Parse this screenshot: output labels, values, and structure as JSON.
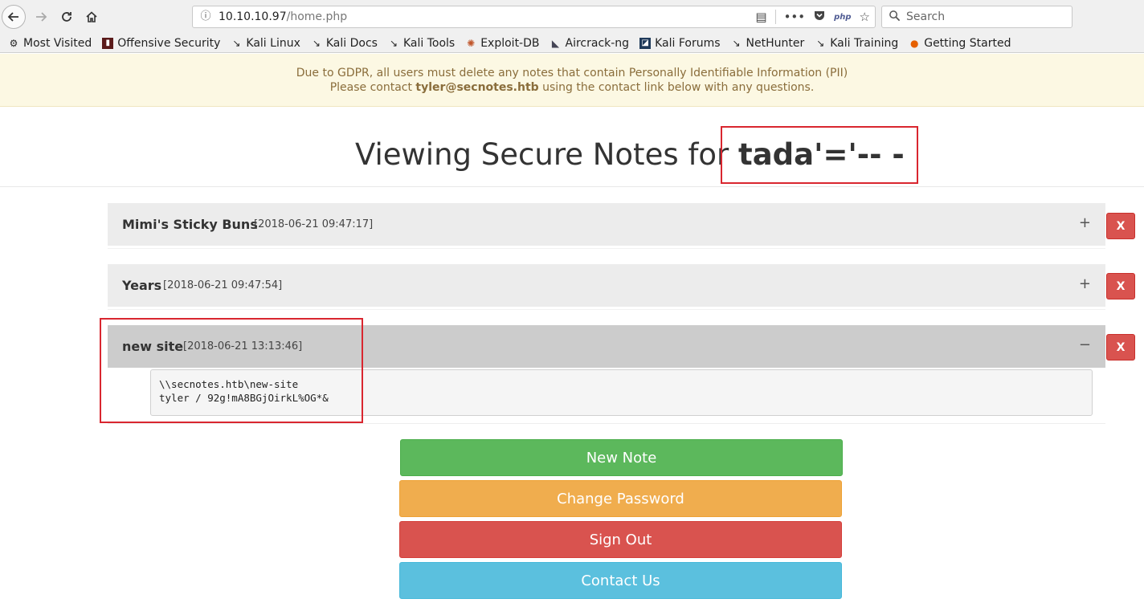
{
  "browser": {
    "url_host": "10.10.10.97",
    "url_path": "/home.php",
    "search_placeholder": "Search",
    "php_badge": "php",
    "bookmarks": [
      {
        "label": "Most Visited",
        "icon": "gear-icon"
      },
      {
        "label": "Offensive Security",
        "icon": "offsec-icon"
      },
      {
        "label": "Kali Linux",
        "icon": "kali-dragon-icon"
      },
      {
        "label": "Kali Docs",
        "icon": "kali-dragon-icon"
      },
      {
        "label": "Kali Tools",
        "icon": "kali-dragon-icon"
      },
      {
        "label": "Exploit-DB",
        "icon": "exploitdb-icon"
      },
      {
        "label": "Aircrack-ng",
        "icon": "aircrack-icon"
      },
      {
        "label": "Kali Forums",
        "icon": "kali-forums-icon"
      },
      {
        "label": "NetHunter",
        "icon": "kali-dragon-icon"
      },
      {
        "label": "Kali Training",
        "icon": "kali-dragon-icon"
      },
      {
        "label": "Getting Started",
        "icon": "firefox-icon"
      }
    ]
  },
  "alert": {
    "line1": "Due to GDPR, all users must delete any notes that contain Personally Identifiable Information (PII)",
    "line2_prefix": "Please contact ",
    "line2_email": "tyler@secnotes.htb",
    "line2_suffix": " using the contact link below with any questions."
  },
  "heading": {
    "prefix": "Viewing Secure Notes for ",
    "username": "tada'='-- -"
  },
  "notes": [
    {
      "title": "Mimi's Sticky Buns",
      "date": "[2018-06-21 09:47:17]",
      "toggle": "+",
      "delete_label": "X"
    },
    {
      "title": "Years",
      "date": "[2018-06-21 09:47:54]",
      "toggle": "+",
      "delete_label": "X"
    },
    {
      "title": "new site",
      "date": "[2018-06-21 13:13:46]",
      "toggle": "−",
      "delete_label": "X",
      "body": "\\\\secnotes.htb\\new-site\ntyler / 92g!mA8BGjOirkL%OG*&"
    }
  ],
  "actions": {
    "new_note": "New Note",
    "change_password": "Change Password",
    "sign_out": "Sign Out",
    "contact_us": "Contact Us"
  },
  "colors": {
    "highlight": "#d9262f",
    "success": "#5cb85c",
    "warning": "#f0ad4e",
    "danger": "#d9534f",
    "info": "#5bc0de"
  }
}
